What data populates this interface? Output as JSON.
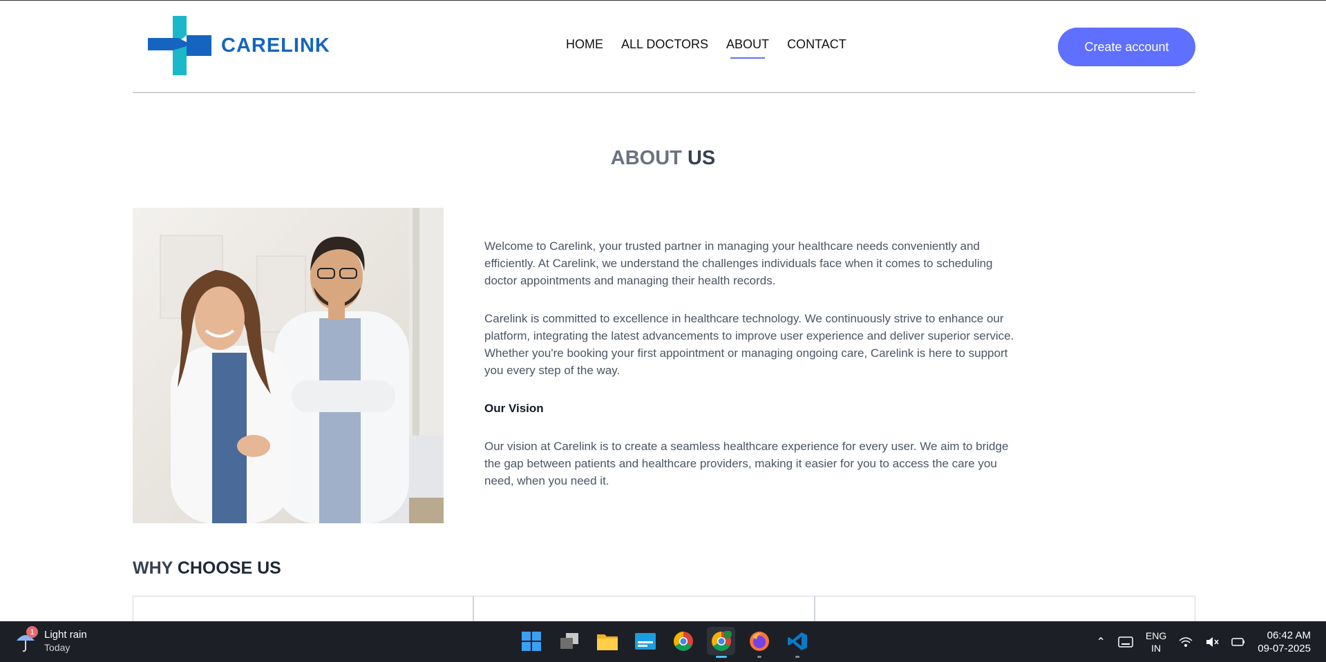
{
  "header": {
    "logo_text": "CARELINK",
    "nav": [
      "HOME",
      "ALL DOCTORS",
      "ABOUT",
      "CONTACT"
    ],
    "active_nav": "ABOUT",
    "create_account_label": "Create account"
  },
  "about": {
    "title_light": "ABOUT",
    "title_bold": "US",
    "paragraph_1": "Welcome to Carelink, your trusted partner in managing your healthcare needs conveniently and efficiently. At Carelink, we understand the challenges individuals face when it comes to scheduling doctor appointments and managing their health records.",
    "paragraph_2": "Carelink is committed to excellence in healthcare technology. We continuously strive to enhance our platform, integrating the latest advancements to improve user experience and deliver superior service. Whether you're booking your first appointment or managing ongoing care, Carelink is here to support you every step of the way.",
    "vision_heading": "Our Vision",
    "paragraph_3": "Our vision at Carelink is to create a seamless healthcare experience for every user. We aim to bridge the gap between patients and healthcare providers, making it easier for you to access the care you need, when you need it."
  },
  "why": {
    "title_light": "WHY",
    "title_bold": "CHOOSE US"
  },
  "taskbar": {
    "weather_main": "Light rain",
    "weather_sub": "Today",
    "weather_badge": "1",
    "apps": [
      "start-icon",
      "task-view-icon",
      "file-explorer-icon",
      "app-icon",
      "chrome-icon",
      "chrome-profile-icon",
      "firefox-icon",
      "vscode-icon"
    ],
    "lang_1": "ENG",
    "lang_2": "IN",
    "time": "06:42 AM",
    "date": "09-07-2025"
  },
  "colors": {
    "accent": "#5f6fff",
    "brand_blue": "#1565c0",
    "brand_teal": "#1ab8c8"
  }
}
